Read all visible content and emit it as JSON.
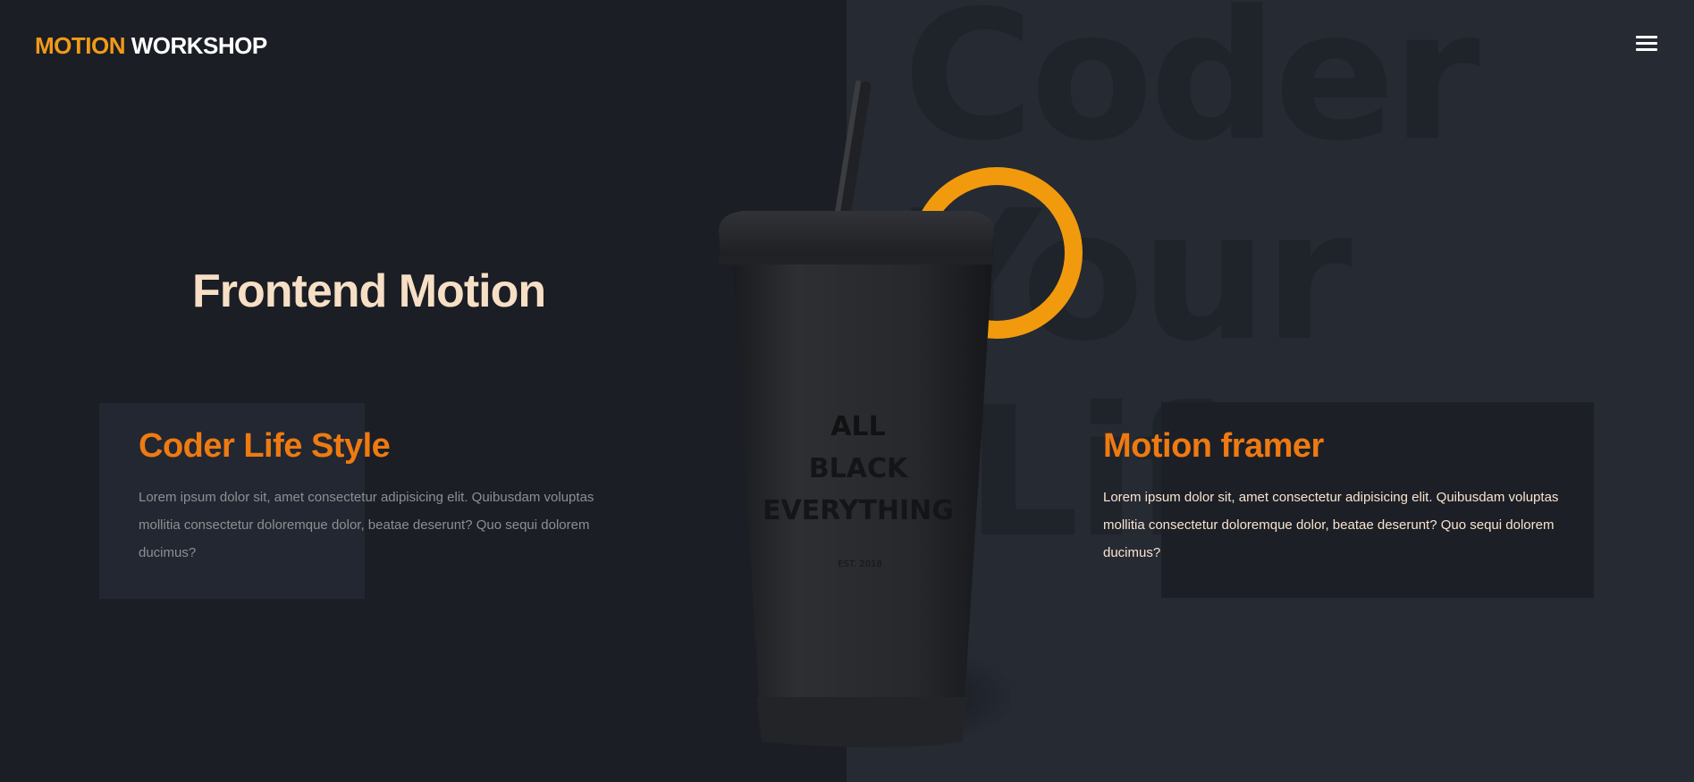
{
  "brand": {
    "accent_word": "MOTION",
    "rest_word": "WORKSHOP",
    "accent_color": "#f29a18"
  },
  "nav": {
    "menu_icon": "hamburger-menu-icon"
  },
  "background_text": [
    "Coder",
    "Your",
    "Life"
  ],
  "hero": {
    "title": "Frontend Motion"
  },
  "cards": [
    {
      "title": "Coder Life Style",
      "body": "Lorem ipsum dolor sit, amet consectetur adipisicing elit. Quibusdam voluptas mollitia consectetur doloremque dolor, beatae deserunt? Quo sequi dolorem ducimus?"
    },
    {
      "title": "Motion framer",
      "body": "Lorem ipsum dolor sit, amet consectetur adipisicing elit. Quibusdam voluptas mollitia consectetur doloremque dolor, beatae deserunt? Quo sequi dolorem ducimus?"
    }
  ],
  "product": {
    "cup_text": [
      "ALL",
      "BLACK",
      "EVERYTHING"
    ],
    "cup_small": "EST. 2018",
    "ring_color": "#f29a0e"
  },
  "colors": {
    "background_left": "#1b1e24",
    "background_right": "#262a33",
    "heading_orange": "#ee7a12",
    "hero_cream": "#f7dfc6"
  }
}
